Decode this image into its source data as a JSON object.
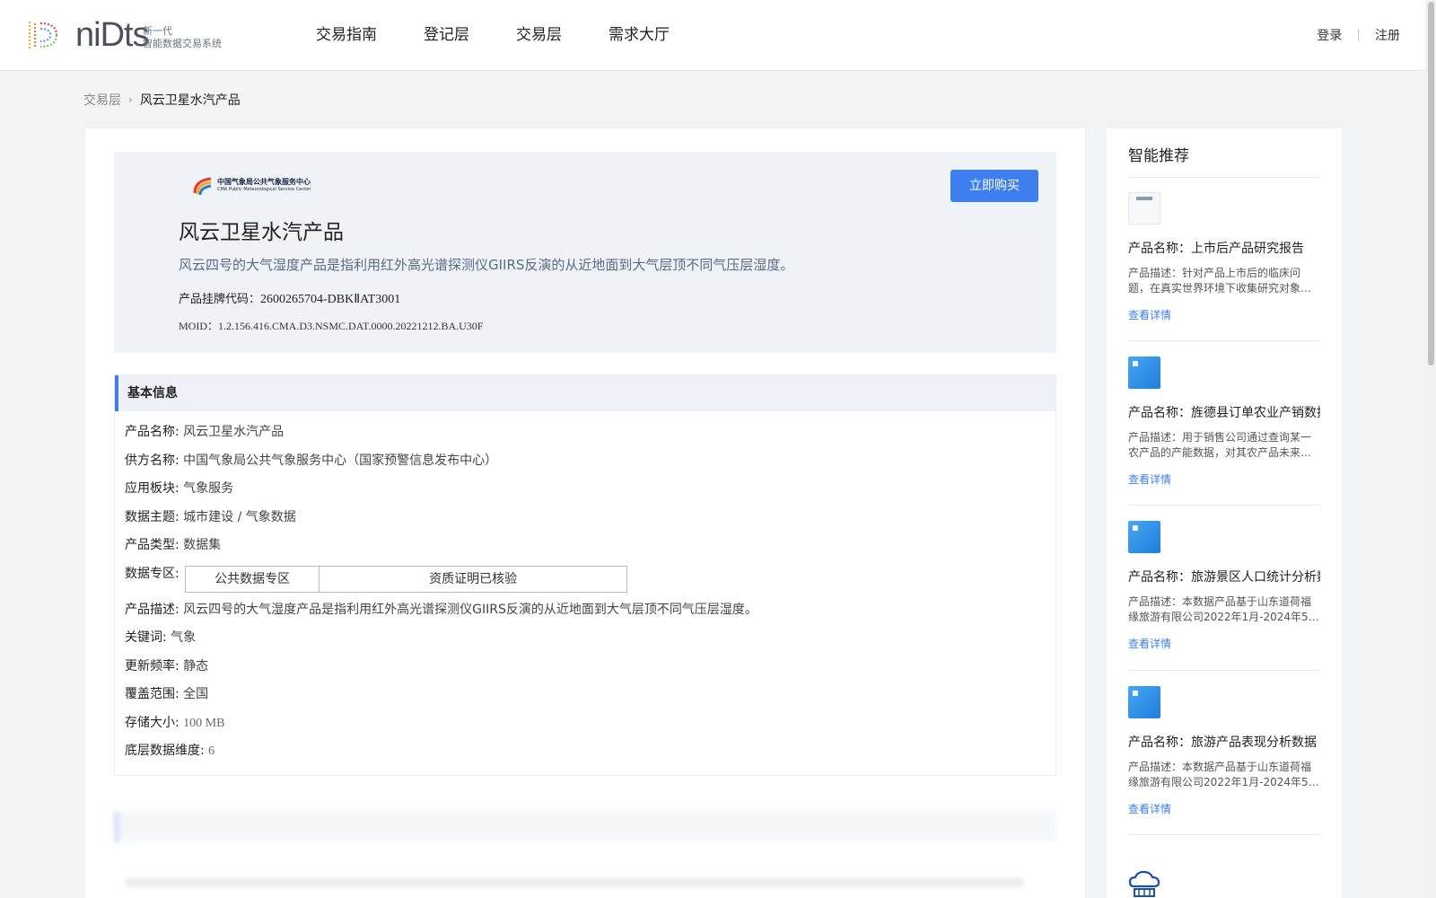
{
  "header": {
    "logo_word": "niDts",
    "logo_sub_line1": "新一代",
    "logo_sub_line2": "智能数据交易系统",
    "nav": [
      "交易指南",
      "登记层",
      "交易层",
      "需求大厅"
    ],
    "login": "登录",
    "register": "注册",
    "auth_separator": "|"
  },
  "breadcrumb": {
    "parent": "交易层",
    "separator": "›",
    "current": "风云卫星水汽产品"
  },
  "hero": {
    "provider_logo_cn": "中国气象局公共气象服务中心",
    "provider_logo_en": "CMA Public Meteorological Service Center",
    "buy_label": "立即购买",
    "title": "风云卫星水汽产品",
    "description": "风云四号的大气湿度产品是指利用红外高光谱探测仪GIIRS反演的从近地面到大气层顶不同气压层湿度。",
    "code_label": "产品挂牌代码：",
    "code_value": "2600265704-DBKⅡAT3001",
    "moid": "MOID：1.2.156.416.CMA.D3.NSMC.DAT.0000.20221212.BA.U30F"
  },
  "basic_info": {
    "title": "基本信息",
    "product_name_label": "产品名称:",
    "product_name": "风云卫星水汽产品",
    "supplier_label": "供方名称:",
    "supplier": "中国气象局公共气象服务中心（国家预警信息发布中心）",
    "sector_label": "应用板块:",
    "sector": "气象服务",
    "theme_label": "数据主题:",
    "theme": "城市建设 / 气象数据",
    "type_label": "产品类型:",
    "type": "数据集",
    "zone_label": "数据专区:",
    "zones": [
      "公共数据专区",
      "资质证明已核验"
    ],
    "desc_label": "产品描述:",
    "desc": "风云四号的大气湿度产品是指利用红外高光谱探测仪GIIRS反演的从近地面到大气层顶不同气压层湿度。",
    "keywords_label": "关键词:",
    "keywords": "气象",
    "frequency_label": "更新频率:",
    "frequency": "静态",
    "coverage_label": "覆盖范围:",
    "coverage": "全国",
    "storage_label": "存储大小:",
    "storage": "100 MB",
    "dimension_label": "底层数据维度:",
    "dimension": "6"
  },
  "sidebar": {
    "title": "智能推荐",
    "items": [
      {
        "name": "产品名称：上市后产品研究报告",
        "desc": "产品描述：针对产品上市后的临床问题，在真实世界环境下收集研究对象…",
        "link": "查看详情",
        "thumb": "document-thumbnail"
      },
      {
        "name": "产品名称：旌德县订单农业产销数据",
        "desc": "产品描述：用于销售公司通过查询某一农产品的产能数据，对其农产品未来…",
        "link": "查看详情",
        "thumb": "blue-thumbnail"
      },
      {
        "name": "产品名称：旅游景区人口统计分析数据",
        "desc": "产品描述：本数据产品基于山东道荷福缘旅游有限公司2022年1月-2024年5月…",
        "link": "查看详情",
        "thumb": "blue-thumbnail"
      },
      {
        "name": "产品名称：旅游产品表现分析数据",
        "desc": "产品描述：本数据产品基于山东道荷福缘旅游有限公司2022年1月-2024年5月…",
        "link": "查看详情",
        "thumb": "blue-thumbnail"
      }
    ]
  },
  "colors": {
    "accent": "#3d7ef0",
    "page_bg": "#f2f3f5",
    "hero_bg": "#eff3f8"
  }
}
